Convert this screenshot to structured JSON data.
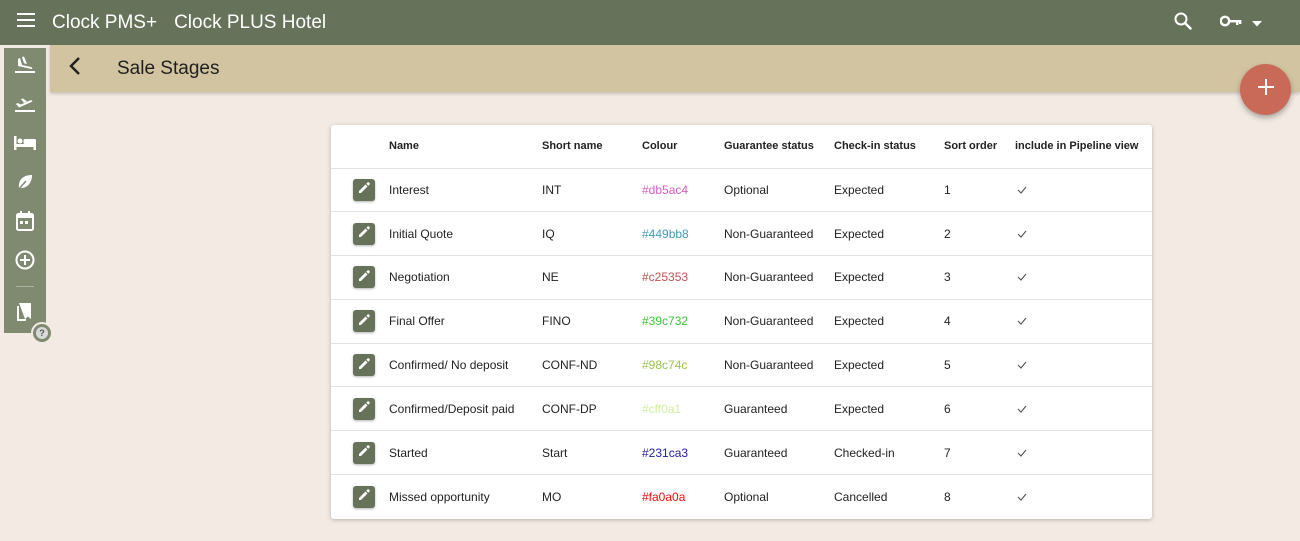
{
  "header": {
    "app_name": "Clock PMS+",
    "hotel_name": "Clock PLUS Hotel",
    "menu_icon": "menu-icon",
    "search_icon": "search-icon",
    "key_icon": "key-icon"
  },
  "page": {
    "title": "Sale Stages"
  },
  "sidebar": {
    "items": [
      {
        "icon": "arrivals-icon"
      },
      {
        "icon": "departures-icon"
      },
      {
        "icon": "bed-icon"
      },
      {
        "icon": "leaf-icon"
      },
      {
        "icon": "calendar-icon"
      },
      {
        "icon": "add-circle-icon"
      },
      {
        "icon": "bookmark-icon"
      }
    ],
    "help_label": "?"
  },
  "table": {
    "columns": [
      "Name",
      "Short name",
      "Colour",
      "Guarantee status",
      "Check-in status",
      "Sort order",
      "include in Pipeline view"
    ],
    "rows": [
      {
        "name": "Interest",
        "short": "INT",
        "colour": "#db5ac4",
        "guarantee": "Optional",
        "checkin": "Expected",
        "sort": "1",
        "pipeline": "✓"
      },
      {
        "name": "Initial Quote",
        "short": "IQ",
        "colour": "#449bb8",
        "guarantee": "Non-Guaranteed",
        "checkin": "Expected",
        "sort": "2",
        "pipeline": "✓"
      },
      {
        "name": "Negotiation",
        "short": "NE",
        "colour": "#c25353",
        "guarantee": "Non-Guaranteed",
        "checkin": "Expected",
        "sort": "3",
        "pipeline": "✓"
      },
      {
        "name": "Final Offer",
        "short": "FINO",
        "colour": "#39c732",
        "guarantee": "Non-Guaranteed",
        "checkin": "Expected",
        "sort": "4",
        "pipeline": "✓"
      },
      {
        "name": "Confirmed/ No deposit",
        "short": "CONF-ND",
        "colour": "#98c74c",
        "guarantee": "Non-Guaranteed",
        "checkin": "Expected",
        "sort": "5",
        "pipeline": "✓"
      },
      {
        "name": "Confirmed/Deposit paid",
        "short": "CONF-DP",
        "colour": "#cff0a1",
        "guarantee": "Guaranteed",
        "checkin": "Expected",
        "sort": "6",
        "pipeline": "✓"
      },
      {
        "name": "Started",
        "short": "Start",
        "colour": "#231ca3",
        "guarantee": "Guaranteed",
        "checkin": "Checked-in",
        "sort": "7",
        "pipeline": "✓"
      },
      {
        "name": "Missed opportunity",
        "short": "MO",
        "colour": "#fa0a0a",
        "guarantee": "Optional",
        "checkin": "Cancelled",
        "sort": "8",
        "pipeline": "✓"
      }
    ]
  },
  "theme": {
    "topbar": "#66725a",
    "subheader": "#d2c4a0",
    "background": "#f3ebe3",
    "fab": "#c86a57"
  }
}
